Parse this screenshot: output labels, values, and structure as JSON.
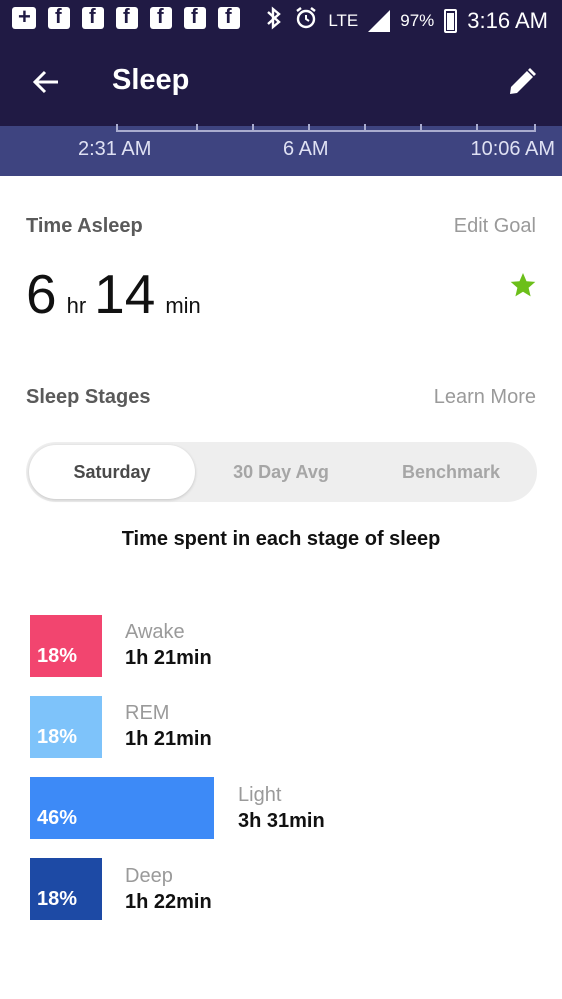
{
  "status_bar": {
    "lte": "LTE",
    "battery": "97%",
    "time": "3:16 AM"
  },
  "header": {
    "title": "Sleep",
    "back_icon": "arrow-left-icon",
    "edit_icon": "pencil-icon"
  },
  "timeline": {
    "start": "2:31 AM",
    "mid": "6 AM",
    "end": "10:06 AM"
  },
  "time_asleep": {
    "title": "Time Asleep",
    "edit_goal": "Edit Goal",
    "hours": "6",
    "hours_unit": "hr",
    "minutes": "14",
    "minutes_unit": "min",
    "goal_icon": "star-icon",
    "goal_color": "#6cbf1a"
  },
  "sleep_stages": {
    "title": "Sleep Stages",
    "learn_more": "Learn More",
    "tabs": [
      {
        "label": "Saturday",
        "active": true
      },
      {
        "label": "30 Day Avg",
        "active": false
      },
      {
        "label": "Benchmark",
        "active": false
      }
    ],
    "heading": "Time spent in each stage of sleep",
    "stages": [
      {
        "name": "Awake",
        "percent": "18%",
        "duration": "1h 21min",
        "color": "#f2456f"
      },
      {
        "name": "REM",
        "percent": "18%",
        "duration": "1h 21min",
        "color": "#7ec3fa"
      },
      {
        "name": "Light",
        "percent": "46%",
        "duration": "3h 31min",
        "color": "#3d8af7"
      },
      {
        "name": "Deep",
        "percent": "18%",
        "duration": "1h 22min",
        "color": "#1d4aa5"
      }
    ]
  }
}
